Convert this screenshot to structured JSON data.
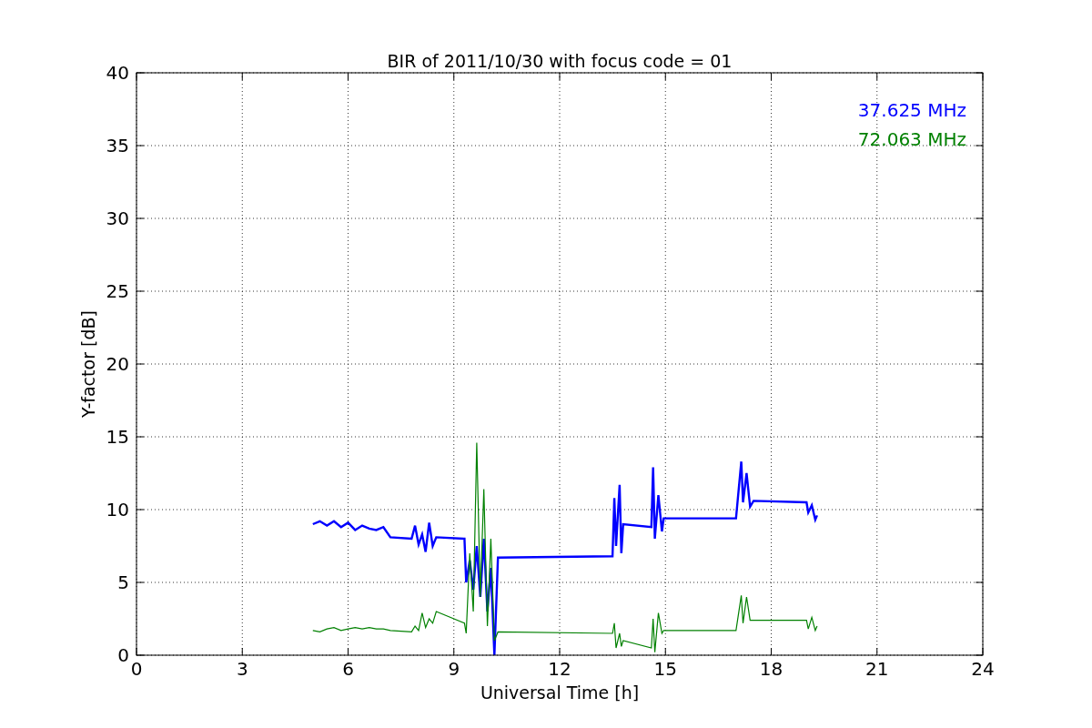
{
  "chart_data": {
    "type": "line",
    "title": "BIR of 2011/10/30 with focus code = 01",
    "xlabel": "Universal Time [h]",
    "ylabel": "Y-factor [dB]",
    "x": [
      5.0,
      5.2,
      5.4,
      5.6,
      5.8,
      6.0,
      6.2,
      6.4,
      6.6,
      6.8,
      7.0,
      7.2,
      7.8,
      7.9,
      8.0,
      8.1,
      8.2,
      8.3,
      8.4,
      8.5,
      9.3,
      9.35,
      9.45,
      9.55,
      9.65,
      9.75,
      9.85,
      9.95,
      10.05,
      10.15,
      10.25,
      13.5,
      13.55,
      13.6,
      13.7,
      13.75,
      13.8,
      14.6,
      14.65,
      14.7,
      14.8,
      14.9,
      14.95,
      17.0,
      17.15,
      17.2,
      17.3,
      17.4,
      17.5,
      19.0,
      19.05,
      19.15,
      19.25,
      19.3
    ],
    "series": [
      {
        "name": "37.625 MHz",
        "color": "#0000ff",
        "values": [
          9.0,
          9.2,
          8.9,
          9.2,
          8.8,
          9.1,
          8.6,
          8.9,
          8.7,
          8.6,
          8.8,
          8.1,
          8.0,
          8.9,
          7.6,
          8.3,
          7.1,
          9.1,
          7.5,
          8.1,
          8.0,
          5.0,
          6.5,
          4.5,
          7.5,
          4.0,
          8.0,
          3.0,
          6.0,
          0.0,
          6.7,
          6.8,
          10.8,
          7.5,
          11.7,
          7.0,
          9.0,
          8.8,
          12.9,
          8.0,
          11.0,
          8.5,
          9.4,
          9.4,
          13.3,
          10.5,
          12.5,
          10.2,
          10.6,
          10.5,
          9.8,
          10.3,
          9.3,
          9.6
        ]
      },
      {
        "name": "72.063 MHz",
        "color": "#008000",
        "values": [
          1.7,
          1.6,
          1.8,
          1.9,
          1.7,
          1.8,
          1.9,
          1.8,
          1.9,
          1.8,
          1.8,
          1.7,
          1.6,
          2.0,
          1.7,
          2.9,
          1.9,
          2.5,
          2.2,
          3.0,
          2.2,
          1.5,
          7.0,
          3.0,
          14.6,
          4.0,
          11.4,
          2.0,
          8.0,
          1.0,
          1.6,
          1.5,
          2.2,
          0.5,
          1.5,
          0.6,
          1.0,
          0.5,
          2.5,
          0.2,
          2.9,
          1.5,
          1.7,
          1.7,
          4.1,
          2.2,
          4.0,
          2.4,
          2.4,
          2.4,
          1.8,
          2.6,
          1.7,
          2.0
        ]
      }
    ],
    "grid": true,
    "xlim": [
      0,
      24
    ],
    "ylim": [
      0,
      40
    ],
    "xticks": [
      0,
      3,
      6,
      9,
      12,
      15,
      18,
      21,
      24
    ],
    "yticks": [
      0,
      5,
      10,
      15,
      20,
      25,
      30,
      35,
      40
    ]
  }
}
